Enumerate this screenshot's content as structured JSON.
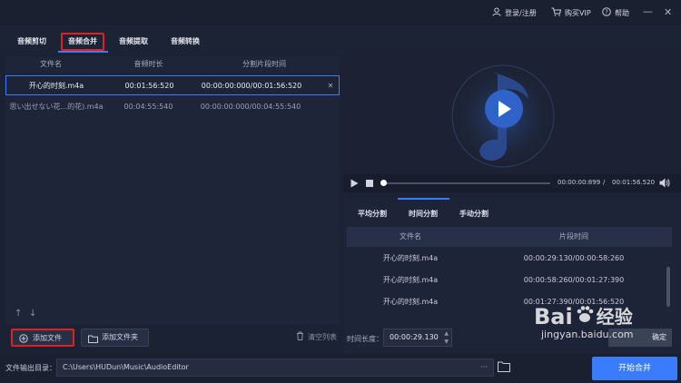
{
  "topbar": {
    "login_label": "登录/注册",
    "vip_label": "购买VIP",
    "help_label": "帮助",
    "minimize": "—",
    "close": "✕"
  },
  "tabs": [
    {
      "label": "音频剪切"
    },
    {
      "label": "音频合并"
    },
    {
      "label": "音频提取"
    },
    {
      "label": "音频转换"
    }
  ],
  "file_table": {
    "headers": [
      "文件名",
      "音频时长",
      "分割片段时间"
    ],
    "rows": [
      {
        "name": "开心的时刻.m4a",
        "duration": "00:01:56:520",
        "segment": "00:00:00:000/00:01:56:520"
      },
      {
        "name": "思い出せない花...的花).m4a",
        "duration": "00:04:55:540",
        "segment": "00:00:00:000/00:04:55:540"
      }
    ]
  },
  "bottom_left": {
    "add_file": "添加文件",
    "add_folder": "添加文件夹",
    "clear_list": "清空列表"
  },
  "player": {
    "current_time": "00:00:00:899",
    "separator": "/",
    "total_time": "00:01:56.520"
  },
  "split": {
    "tabs": [
      "平均分割",
      "时间分割",
      "手动分割"
    ],
    "headers": [
      "文件名",
      "片段时间"
    ],
    "rows": [
      {
        "name": "开心的时刻.m4a",
        "segment": "00:00:29:130/00:00:58:260"
      },
      {
        "name": "开心的时刻.m4a",
        "segment": "00:00:58:260/00:01:27:390"
      },
      {
        "name": "开心的时刻.m4a",
        "segment": "00:01:27:390/00:01:56:520"
      }
    ],
    "length_label": "时间长度：",
    "length_value": "00:00:29.130",
    "confirm_label": "确定"
  },
  "footer": {
    "output_label": "文件输出目录：",
    "output_path": "C:\\Users\\HUDun\\Music\\AudioEditor",
    "dots": "···",
    "start_label": "开始合并"
  },
  "watermark": {
    "brand": "Bai",
    "brand_cn": "经验",
    "url": "jingyan.baidu.com"
  },
  "colors": {
    "accent": "#3b7cff",
    "highlight_box": "#e02020",
    "background": "#1b2233"
  }
}
